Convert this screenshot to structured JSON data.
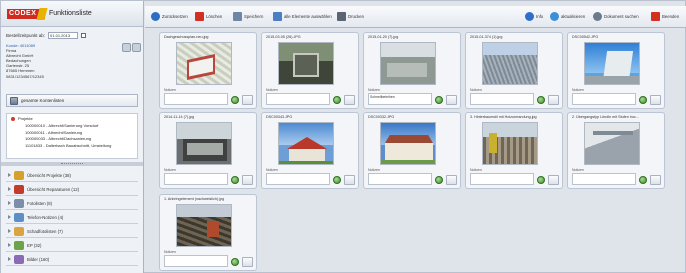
{
  "sidebar": {
    "logo": "CODEX",
    "title": "Funktionsliste",
    "date_label": "Bestellzeitpunkt ab:",
    "date_value": "01.01.2013",
    "user": {
      "name": "Kunde: 4011089",
      "lines": [
        "Firma",
        "Albrecht GmbH",
        "Bedachungen",
        "Gartenstr. 25",
        "87665 Hemmen",
        "0831/1234567/12345"
      ]
    },
    "sections": [
      {
        "label": "gesamte Kontenlisten"
      },
      {
        "label": "Projekte"
      }
    ],
    "projects": [
      "100000010 - Albrecht/Sanierung Vorsdorf",
      "100000011 - Albrecht/Sanierung",
      "100000033 - Albrecht/Dachsanierung",
      "11101833 - Dallerbach Bauabschnitt, Umstellung"
    ],
    "categories": [
      {
        "label": "Übersicht Projekte  (38)",
        "color": "#d4a12b"
      },
      {
        "label": "Übersicht Reparaturen  (12)",
        "color": "#c23b2d"
      },
      {
        "label": "Fotolisten (8)",
        "color": "#7b8fa8"
      },
      {
        "label": "Telefon-Notizen (4)",
        "color": "#5c8ec8"
      },
      {
        "label": "Schadfotolisten (7)",
        "color": "#d9a441"
      },
      {
        "label": "EP (32)",
        "color": "#6ba34a"
      },
      {
        "label": "Bilder (160)",
        "color": "#8b6bb5"
      }
    ]
  },
  "toolbar": {
    "buttons": [
      {
        "label": "Zurücksetzen",
        "color": "#2b6fc4"
      },
      {
        "label": "Löschen",
        "color": "#d32f23"
      },
      {
        "label": "Speichern",
        "color": "#6d86a8"
      },
      {
        "label": "alle Elemente auswählen",
        "color": "#4b7ec2"
      },
      {
        "label": "Drucken",
        "color": "#5a6472"
      }
    ],
    "right_buttons": [
      {
        "label": "Info",
        "color": "#2f6fc9"
      },
      {
        "label": "aktualisieren",
        "color": "#3b8fd6"
      },
      {
        "label": "Dokument suchen",
        "color": "#6b7a8c"
      },
      {
        "label": "Beenden",
        "color": "#d32f23"
      }
    ]
  },
  "cards": [
    {
      "filename": "Dachgeschossplan-neu.jpg",
      "notiz": "Notizen",
      "note_value": ""
    },
    {
      "filename": "2015-03-05 (26).JPG",
      "notiz": "Notizen",
      "note_value": ""
    },
    {
      "filename": "2015-01-20 (7).jpg",
      "notiz": "Notizen",
      "note_value": "Schnellbeleihen"
    },
    {
      "filename": "2015-01-374 (1).jpg",
      "notiz": "Notizen",
      "note_value": ""
    },
    {
      "filename": "DSC00542.JPG",
      "notiz": "Notizen",
      "note_value": ""
    },
    {
      "filename": "2014-11-14 (7).jpg",
      "notiz": "Notizen",
      "note_value": ""
    },
    {
      "filename": "DSC00343.JPG",
      "notiz": "Notizen",
      "note_value": ""
    },
    {
      "filename": "DSC00332.JPG",
      "notiz": "Notizen",
      "note_value": ""
    },
    {
      "filename": "3. Hinterbaumstil mit Holzumrandung.jpg",
      "notiz": "Notizen",
      "note_value": ""
    },
    {
      "filename": "2. Übergangstyp Löndln mit Stufen hoc...",
      "notiz": "Notizen",
      "note_value": ""
    },
    {
      "filename": "1. Anbringelement (nachweislich).jpg",
      "notiz": "Notizen",
      "note_value": ""
    }
  ]
}
